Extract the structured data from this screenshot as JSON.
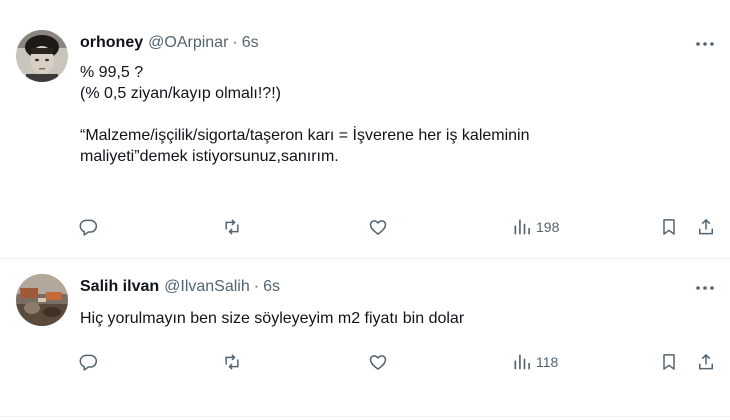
{
  "tweets": [
    {
      "name": "orhoney",
      "handle": "@OArpinar",
      "separator": "·",
      "time": "6s",
      "lines": [
        "% 99,5 ?",
        "(% 0,5 ziyan/kayıp olmalı!?!)",
        "",
        "“Malzeme/işçilik/sigorta/taşeron karı = İşverene her iş kaleminin",
        "maliyeti”demek istiyorsunuz,sanırım."
      ],
      "views": "198",
      "icons": [
        "more-icon",
        "reply-icon",
        "retweet-icon",
        "like-icon",
        "views-icon",
        "bookmark-icon",
        "share-icon"
      ]
    },
    {
      "name": "Salih ilvan",
      "handle": "@IlvanSalih",
      "separator": "·",
      "time": "6s",
      "lines": [
        "Hiç yorulmayın ben size söyleyeyim m2 fiyatı bin dolar"
      ],
      "views": "118",
      "icons": [
        "more-icon",
        "reply-icon",
        "retweet-icon",
        "like-icon",
        "views-icon",
        "bookmark-icon",
        "share-icon"
      ]
    }
  ],
  "colors": {
    "text": "#0f1419",
    "secondary": "#536471",
    "divider": "#eff3f4",
    "background": "#ffffff"
  }
}
